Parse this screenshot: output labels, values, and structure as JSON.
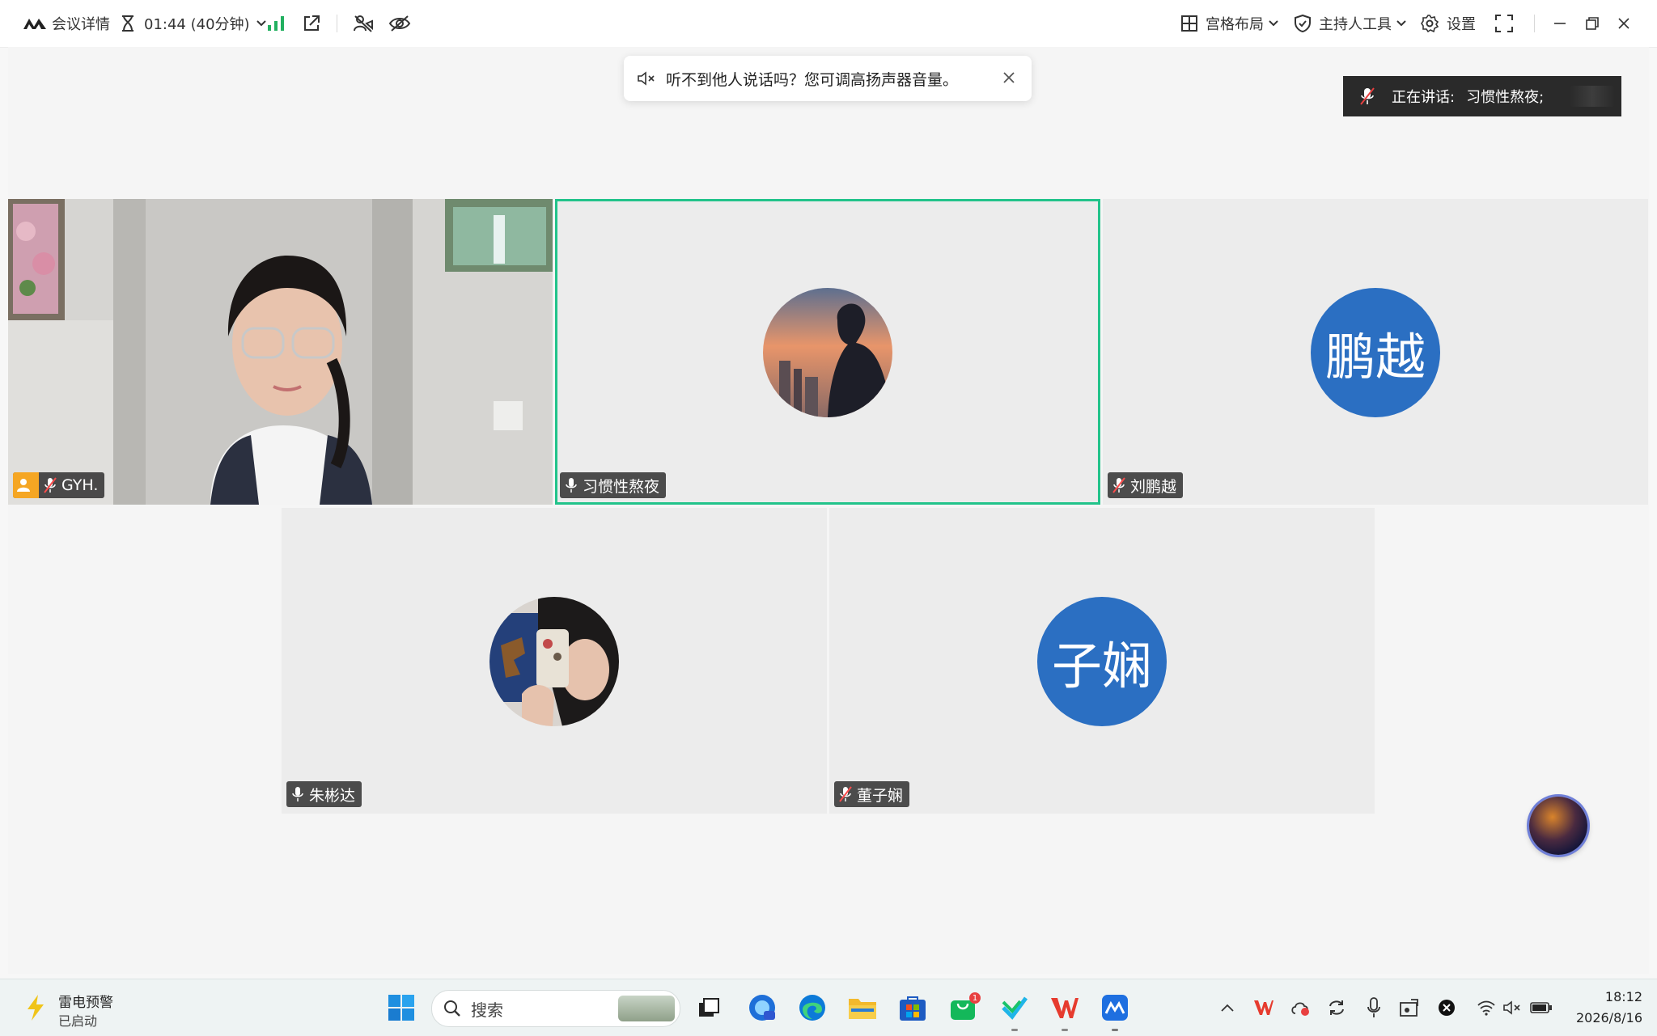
{
  "toolbar": {
    "meeting_details": "会议详情",
    "timer": "01:44 (40分钟)",
    "grid_layout": "宫格布局",
    "host_tools": "主持人工具",
    "settings": "设置"
  },
  "toast": {
    "message": "听不到他人说话吗？您可调高扬声器音量。"
  },
  "speaking": {
    "label": "正在讲话:",
    "name": "习惯性熬夜;"
  },
  "participants": [
    {
      "name": "GYH.",
      "mic": "muted",
      "host": true,
      "video": true
    },
    {
      "name": "习惯性熬夜",
      "mic": "on",
      "active": true
    },
    {
      "name": "刘鹏越",
      "mic": "muted",
      "avatar_text": "鹏越"
    },
    {
      "name": "朱彬达",
      "mic": "on"
    },
    {
      "name": "董子娴",
      "mic": "muted",
      "avatar_text": "子娴"
    }
  ],
  "taskbar": {
    "weather_title": "雷电预警",
    "weather_status": "已启动",
    "search_placeholder": "搜索",
    "time": "18:12",
    "date": "2026/8/16",
    "store_badge": "1"
  },
  "colors": {
    "active_border": "#22c38a",
    "avatar_blue": "#2b6fc2",
    "host_badge": "#f5a623"
  }
}
